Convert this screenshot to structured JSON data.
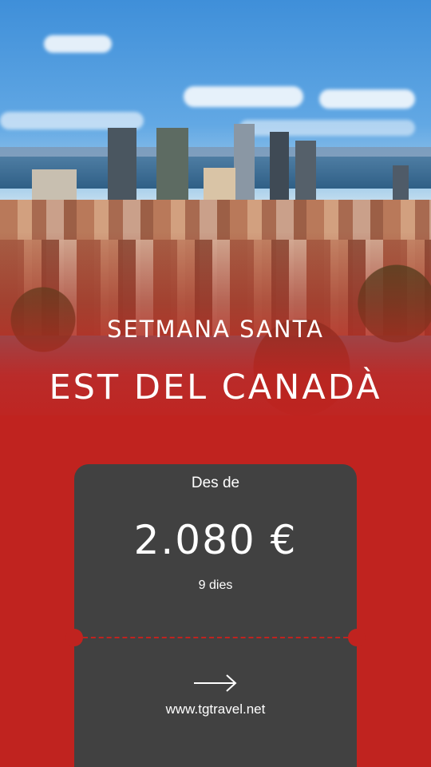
{
  "hero": {
    "image": "montreal-skyline-photo"
  },
  "headline": {
    "subtitle": "SETMANA SANTA",
    "title": "EST DEL CANADÀ"
  },
  "offer": {
    "from_label": "Des de",
    "price": "2.080 €",
    "duration": "9 dies",
    "arrow_icon": "arrow-right-icon",
    "website": "www.tgtravel.net"
  },
  "colors": {
    "background": "#c0231f",
    "card": "#414141",
    "text": "#ffffff"
  }
}
